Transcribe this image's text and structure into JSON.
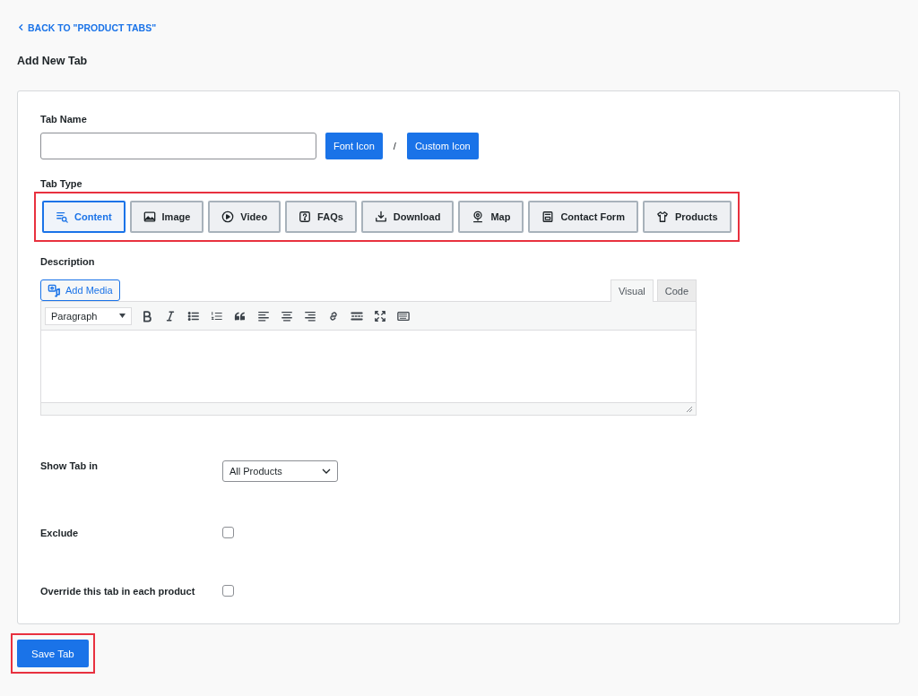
{
  "back_link": "BACK TO \"PRODUCT TABS\"",
  "heading": "Add New Tab",
  "tab_name": {
    "label": "Tab Name"
  },
  "icon_buttons": [
    "Font Icon",
    "Custom Icon"
  ],
  "separator": "/",
  "tab_type": {
    "label": "Tab Type",
    "highlighted": true,
    "options": [
      {
        "label": "Content",
        "selected": true
      },
      {
        "label": "Image",
        "selected": false
      },
      {
        "label": "Video",
        "selected": false
      },
      {
        "label": "FAQs",
        "selected": false
      },
      {
        "label": "Download",
        "selected": false
      },
      {
        "label": "Map",
        "selected": false
      },
      {
        "label": "Contact Form",
        "selected": false
      },
      {
        "label": "Products",
        "selected": false
      }
    ]
  },
  "description": {
    "label": "Description",
    "add_media": "Add Media",
    "format": "Paragraph",
    "modes": [
      {
        "label": "Visual",
        "selected": true
      },
      {
        "label": "Code",
        "selected": false
      }
    ]
  },
  "show_tab_in": {
    "label": "Show Tab in",
    "value": "All Products"
  },
  "checkboxes": [
    {
      "label": "Exclude",
      "checked": false
    },
    {
      "label": "Override this tab in each product",
      "checked": false
    }
  ],
  "save": {
    "label": "Save Tab",
    "highlighted": true
  }
}
